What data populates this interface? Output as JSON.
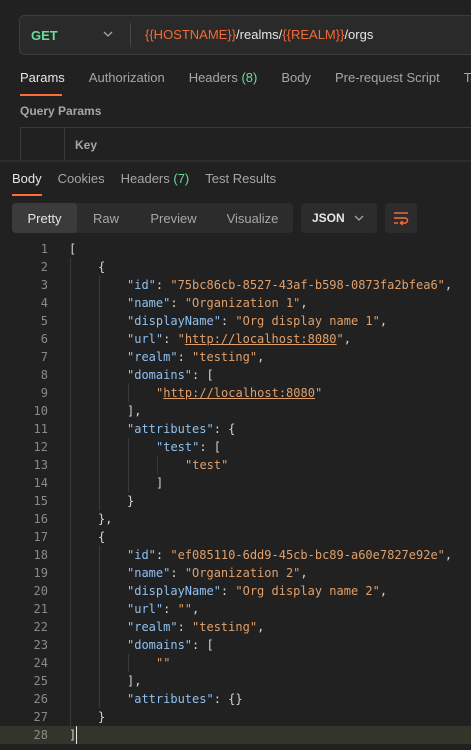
{
  "request": {
    "method": "GET",
    "url_parts": [
      {
        "text": "{{HOSTNAME}}",
        "var": true
      },
      {
        "text": "/realms/",
        "var": false
      },
      {
        "text": "{{REALM}}",
        "var": true
      },
      {
        "text": "/orgs",
        "var": false
      }
    ],
    "tabs": [
      {
        "label": "Params",
        "count": ""
      },
      {
        "label": "Authorization",
        "count": ""
      },
      {
        "label": "Headers",
        "count": "(8)"
      },
      {
        "label": "Body",
        "count": ""
      },
      {
        "label": "Pre-request Script",
        "count": ""
      },
      {
        "label": "Tests",
        "count": ""
      }
    ],
    "query_params_label": "Query Params",
    "key_header": "Key"
  },
  "response": {
    "tabs": [
      {
        "label": "Body",
        "count": ""
      },
      {
        "label": "Cookies",
        "count": ""
      },
      {
        "label": "Headers",
        "count": "(7)"
      },
      {
        "label": "Test Results",
        "count": ""
      }
    ],
    "formats": [
      "Pretty",
      "Raw",
      "Preview",
      "Visualize"
    ],
    "active_format": "Pretty",
    "language": "JSON"
  },
  "editor": {
    "lines": [
      {
        "n": "1",
        "indent": 0,
        "tokens": [
          [
            "p",
            "["
          ]
        ]
      },
      {
        "n": "2",
        "indent": 1,
        "tokens": [
          [
            "p",
            "{"
          ]
        ]
      },
      {
        "n": "3",
        "indent": 2,
        "tokens": [
          [
            "k",
            "\"id\""
          ],
          [
            "p",
            ": "
          ],
          [
            "s",
            "\"75bc86cb-8527-43af-b598-0873fa2bfea6\""
          ],
          [
            "p",
            ","
          ]
        ]
      },
      {
        "n": "4",
        "indent": 2,
        "tokens": [
          [
            "k",
            "\"name\""
          ],
          [
            "p",
            ": "
          ],
          [
            "s",
            "\"Organization 1\""
          ],
          [
            "p",
            ","
          ]
        ]
      },
      {
        "n": "5",
        "indent": 2,
        "tokens": [
          [
            "k",
            "\"displayName\""
          ],
          [
            "p",
            ": "
          ],
          [
            "s",
            "\"Org display name 1\""
          ],
          [
            "p",
            ","
          ]
        ]
      },
      {
        "n": "6",
        "indent": 2,
        "tokens": [
          [
            "k",
            "\"url\""
          ],
          [
            "p",
            ": "
          ],
          [
            "s",
            "\""
          ],
          [
            "u",
            "http://localhost:8080"
          ],
          [
            "s",
            "\""
          ],
          [
            "p",
            ","
          ]
        ]
      },
      {
        "n": "7",
        "indent": 2,
        "tokens": [
          [
            "k",
            "\"realm\""
          ],
          [
            "p",
            ": "
          ],
          [
            "s",
            "\"testing\""
          ],
          [
            "p",
            ","
          ]
        ]
      },
      {
        "n": "8",
        "indent": 2,
        "tokens": [
          [
            "k",
            "\"domains\""
          ],
          [
            "p",
            ": ["
          ]
        ]
      },
      {
        "n": "9",
        "indent": 3,
        "tokens": [
          [
            "s",
            "\""
          ],
          [
            "u",
            "http://localhost:8080"
          ],
          [
            "s",
            "\""
          ]
        ]
      },
      {
        "n": "10",
        "indent": 2,
        "tokens": [
          [
            "p",
            "],"
          ]
        ]
      },
      {
        "n": "11",
        "indent": 2,
        "tokens": [
          [
            "k",
            "\"attributes\""
          ],
          [
            "p",
            ": {"
          ]
        ]
      },
      {
        "n": "12",
        "indent": 3,
        "tokens": [
          [
            "k",
            "\"test\""
          ],
          [
            "p",
            ": ["
          ]
        ]
      },
      {
        "n": "13",
        "indent": 4,
        "tokens": [
          [
            "s",
            "\"test\""
          ]
        ]
      },
      {
        "n": "14",
        "indent": 3,
        "tokens": [
          [
            "p",
            "]"
          ]
        ]
      },
      {
        "n": "15",
        "indent": 2,
        "tokens": [
          [
            "p",
            "}"
          ]
        ]
      },
      {
        "n": "16",
        "indent": 1,
        "tokens": [
          [
            "p",
            "},"
          ]
        ]
      },
      {
        "n": "17",
        "indent": 1,
        "tokens": [
          [
            "p",
            "{"
          ]
        ]
      },
      {
        "n": "18",
        "indent": 2,
        "tokens": [
          [
            "k",
            "\"id\""
          ],
          [
            "p",
            ": "
          ],
          [
            "s",
            "\"ef085110-6dd9-45cb-bc89-a60e7827e92e\""
          ],
          [
            "p",
            ","
          ]
        ]
      },
      {
        "n": "19",
        "indent": 2,
        "tokens": [
          [
            "k",
            "\"name\""
          ],
          [
            "p",
            ": "
          ],
          [
            "s",
            "\"Organization 2\""
          ],
          [
            "p",
            ","
          ]
        ]
      },
      {
        "n": "20",
        "indent": 2,
        "tokens": [
          [
            "k",
            "\"displayName\""
          ],
          [
            "p",
            ": "
          ],
          [
            "s",
            "\"Org display name 2\""
          ],
          [
            "p",
            ","
          ]
        ]
      },
      {
        "n": "21",
        "indent": 2,
        "tokens": [
          [
            "k",
            "\"url\""
          ],
          [
            "p",
            ": "
          ],
          [
            "s",
            "\"\""
          ],
          [
            "p",
            ","
          ]
        ]
      },
      {
        "n": "22",
        "indent": 2,
        "tokens": [
          [
            "k",
            "\"realm\""
          ],
          [
            "p",
            ": "
          ],
          [
            "s",
            "\"testing\""
          ],
          [
            "p",
            ","
          ]
        ]
      },
      {
        "n": "23",
        "indent": 2,
        "tokens": [
          [
            "k",
            "\"domains\""
          ],
          [
            "p",
            ": ["
          ]
        ]
      },
      {
        "n": "24",
        "indent": 3,
        "tokens": [
          [
            "s",
            "\"\""
          ]
        ]
      },
      {
        "n": "25",
        "indent": 2,
        "tokens": [
          [
            "p",
            "],"
          ]
        ]
      },
      {
        "n": "26",
        "indent": 2,
        "tokens": [
          [
            "k",
            "\"attributes\""
          ],
          [
            "p",
            ": {}"
          ]
        ]
      },
      {
        "n": "27",
        "indent": 1,
        "tokens": [
          [
            "p",
            "}"
          ]
        ]
      },
      {
        "n": "28",
        "indent": 0,
        "tokens": [
          [
            "p",
            "]"
          ]
        ]
      }
    ],
    "current_line": "28"
  },
  "colors": {
    "accent": "#ff6c37",
    "method_get": "#6bdd9a",
    "variable": "#f26b3a",
    "json_key": "#8fc0f0",
    "json_string": "#e0a06b"
  }
}
